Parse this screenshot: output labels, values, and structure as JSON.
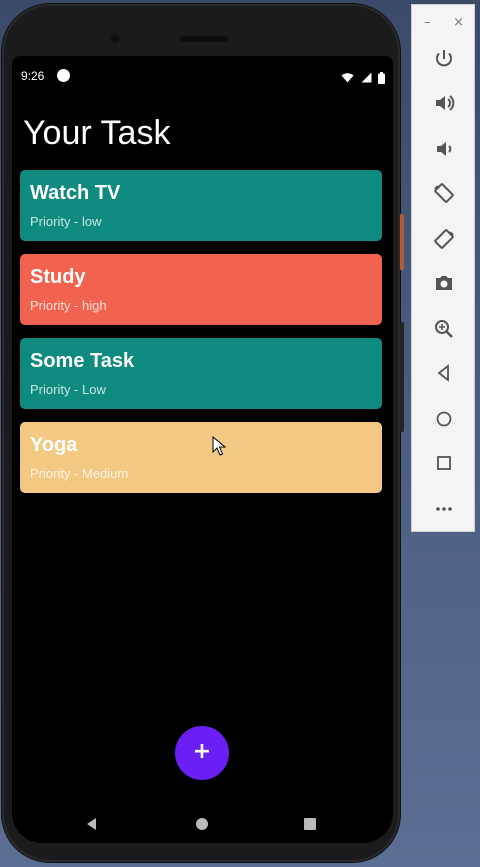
{
  "status_bar": {
    "time": "9:26"
  },
  "app": {
    "title": "Your Task",
    "tasks": [
      {
        "name": "Watch TV",
        "priority": "Priority - low",
        "color": "#0e8a7f"
      },
      {
        "name": "Study",
        "priority": "Priority - high",
        "color": "#f2634f"
      },
      {
        "name": "Some Task",
        "priority": "Priority - Low",
        "color": "#0e8a7f"
      },
      {
        "name": "Yoga",
        "priority": "Priority - Medium",
        "color": "#f2c882"
      }
    ],
    "fab_label": "+",
    "fab_color": "#6a1ff4"
  },
  "emulator_toolbar": {
    "window_controls": [
      "–",
      "×"
    ],
    "buttons": [
      "power-icon",
      "volume-up-icon",
      "volume-down-icon",
      "rotate-left-icon",
      "rotate-right-icon",
      "camera-icon",
      "zoom-icon",
      "back-icon",
      "home-icon",
      "overview-icon",
      "more-icon"
    ]
  },
  "navigation": [
    "back-icon",
    "home-icon",
    "recents-icon"
  ]
}
